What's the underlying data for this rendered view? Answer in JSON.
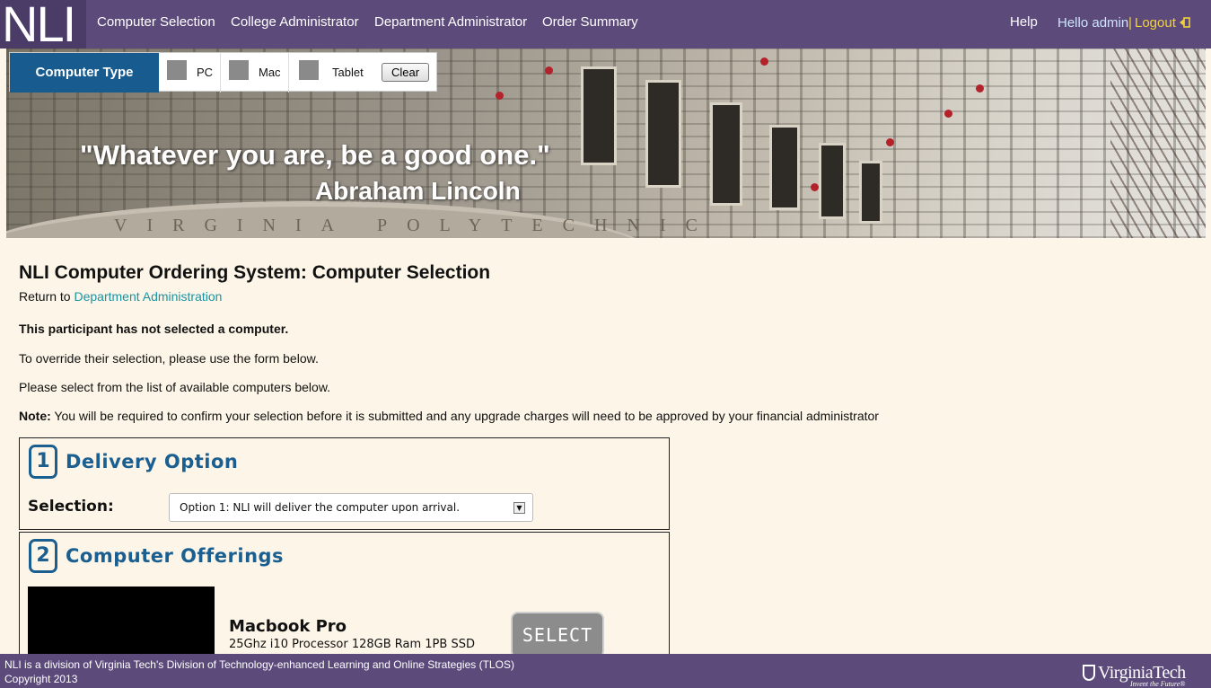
{
  "nav": {
    "logo": "NLI",
    "links": [
      "Computer Selection",
      "College Administrator",
      "Department Administrator",
      "Order Summary"
    ],
    "help": "Help",
    "greeting": "Hello admin",
    "separator": "|",
    "logout": "Logout"
  },
  "banner": {
    "quote": "\"Whatever you are, be a good one.\"",
    "author": "Abraham Lincoln",
    "inscription": "VIRGINIA POLYTECHNIC"
  },
  "filter": {
    "label": "Computer Type",
    "options": [
      "PC",
      "Mac",
      "Tablet"
    ],
    "clear": "Clear"
  },
  "main": {
    "title": "NLI Computer Ordering System: Computer Selection",
    "return_prefix": "Return to",
    "return_link": "Department Administration",
    "status": "This participant has not selected a computer.",
    "override": "To override their selection, please use the form below.",
    "instruction": "Please select from the list of available computers below.",
    "note_label": "Note:",
    "note_text": " You will be required to confirm your selection before it is submitted and any upgrade charges will need to be approved by your financial administrator"
  },
  "delivery": {
    "step": "1",
    "title": "Delivery Option",
    "selection_label": "Selection:",
    "selected": "Option 1: NLI will deliver the computer upon arrival."
  },
  "offerings": {
    "step": "2",
    "title": "Computer Offerings",
    "items": [
      {
        "name": "Macbook Pro",
        "spec": "25Ghz i10 Processor 128GB Ram 1PB SSD",
        "button": "SELECT"
      }
    ]
  },
  "footer": {
    "line1": "NLI is a division of Virginia Tech's Division of Technology-enhanced Learning and Online Strategies (TLOS)",
    "line2": "Copyright 2013",
    "brand": "VirginiaTech",
    "tagline": "Invent the Future®"
  },
  "colors": {
    "nav_bg": "#5b4a7a",
    "accent_blue": "#1b5f91",
    "link": "#1a93a3",
    "logout": "#f3d23c",
    "page_bg": "#fdf6e8"
  }
}
